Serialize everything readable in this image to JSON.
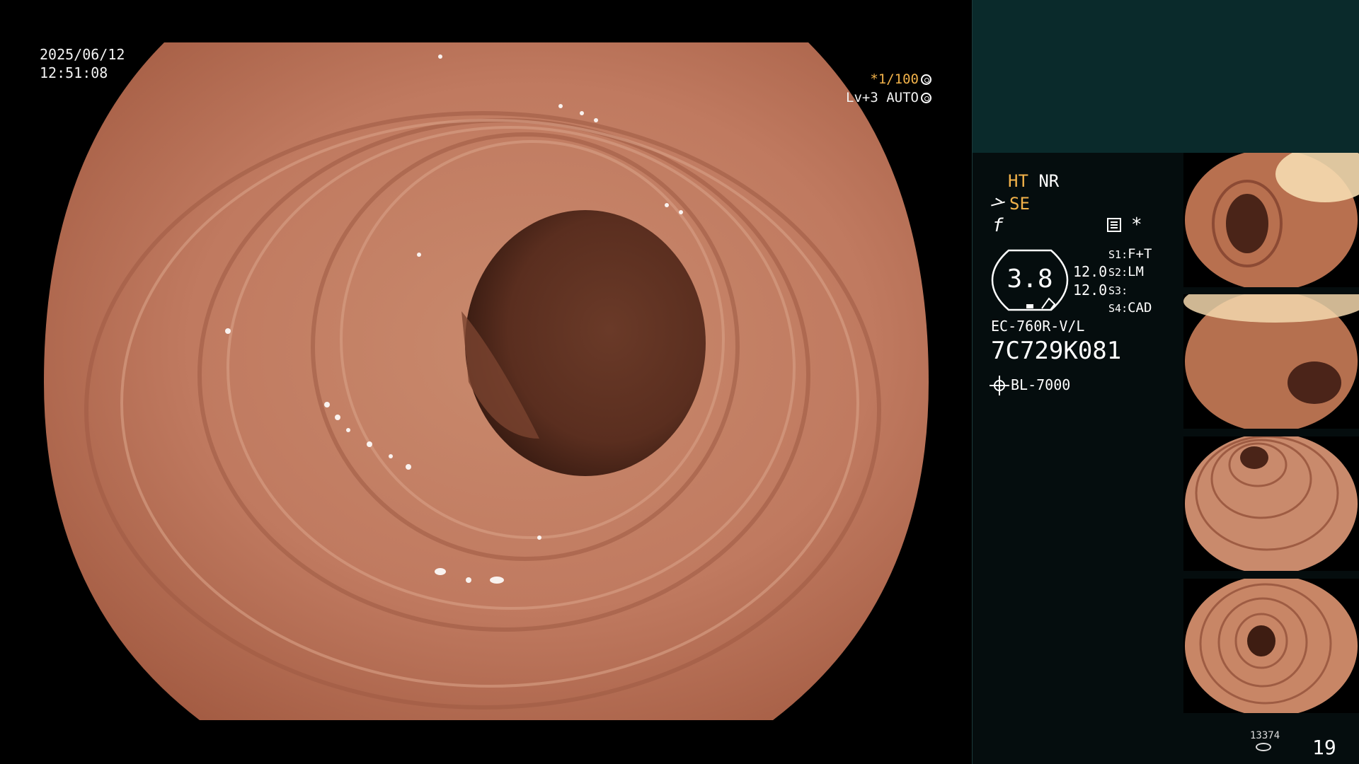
{
  "osd": {
    "date": "2025/06/12",
    "time": "12:51:08",
    "shutter": "*1/100",
    "level": "Lv+3",
    "mode": "AUTO"
  },
  "status": {
    "ht": "HT",
    "nr": "NR",
    "se": "SE",
    "f_symbol": "f",
    "star": "*"
  },
  "gauge": {
    "value": "3.8",
    "val_a": "12.0",
    "val_b": "12.0"
  },
  "switches": [
    {
      "key": "S1",
      "value": "F+T"
    },
    {
      "key": "S2",
      "value": "LM"
    },
    {
      "key": "S3",
      "value": ""
    },
    {
      "key": "S4",
      "value": "CAD"
    }
  ],
  "scope": {
    "model": "EC-760R-V/L",
    "serial": "7C729K081"
  },
  "light_source": "BL-7000",
  "counter": {
    "small": "13374",
    "big": "19"
  },
  "colors": {
    "panel_top": "#0a2a2b",
    "panel": "#050d0e",
    "highlight": "#f2b24a",
    "tissue": "#b96f55"
  },
  "icons": [
    "shutter-dial-icon",
    "auto-mode-icon",
    "se-icon",
    "cad-panel-icon",
    "light-source-icon",
    "counter-icon"
  ]
}
